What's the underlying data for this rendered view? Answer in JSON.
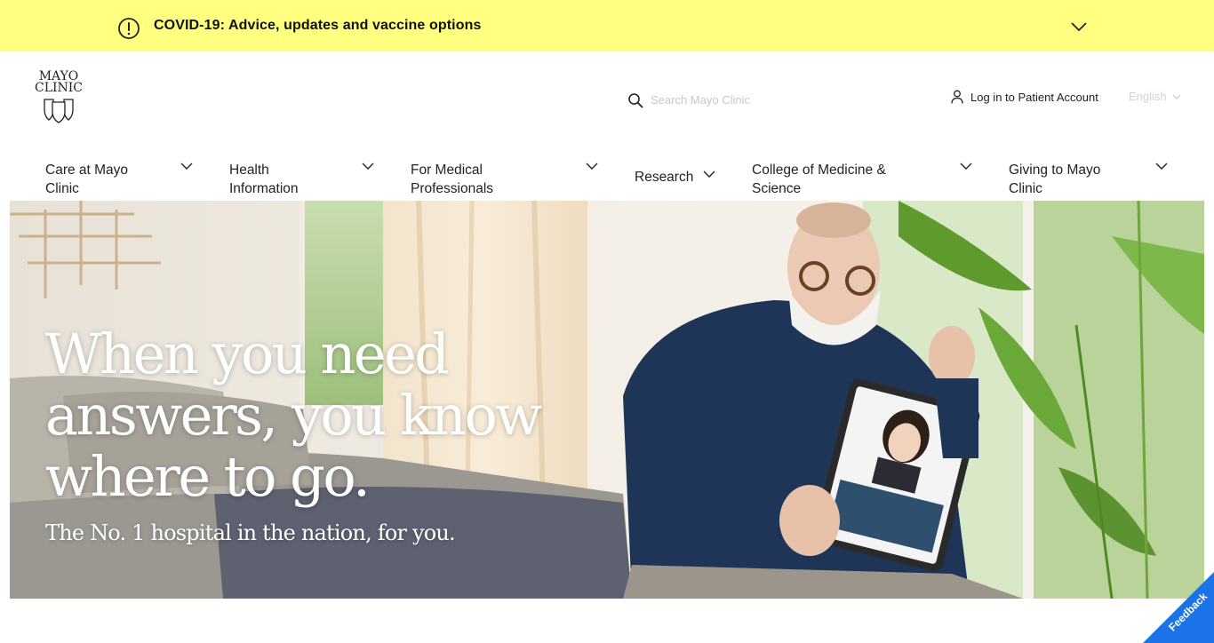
{
  "covid_banner": {
    "text": "COVID-19: Advice, updates and vaccine options",
    "icon": "alert-circle-icon",
    "bg_color": "#ffff80"
  },
  "header": {
    "logo_line1": "MAYO",
    "logo_line2": "CLINIC",
    "search_placeholder": "Search Mayo Clinic",
    "login_label": "Log in to Patient Account",
    "language": "English"
  },
  "nav": {
    "items": [
      {
        "label": "Care at Mayo Clinic"
      },
      {
        "label": "Health Information"
      },
      {
        "label": "For Medical Professionals"
      },
      {
        "label": "Research"
      },
      {
        "label": "College of Medicine & Science"
      },
      {
        "label": "Giving to Mayo Clinic"
      }
    ]
  },
  "hero": {
    "title": "When you need answers, you know where to go.",
    "subtitle": "The No. 1 hospital in the nation, for you."
  },
  "feedback": {
    "label": "Feedback",
    "color": "#1a73e8"
  }
}
